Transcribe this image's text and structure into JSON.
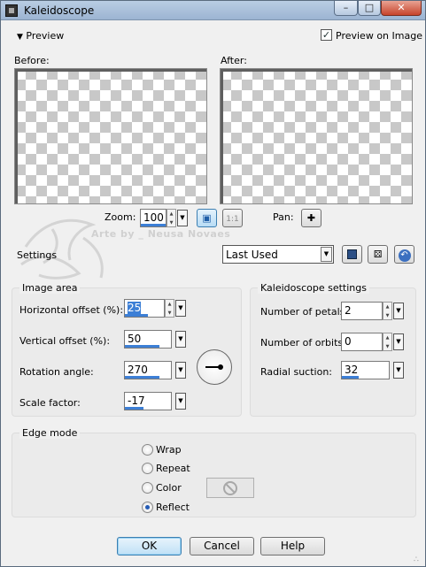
{
  "window": {
    "title": "Kaleidoscope"
  },
  "preview": {
    "toggle_label": "Preview",
    "preview_on_image_label": "Preview on Image",
    "preview_on_image_checked": true,
    "before_label": "Before:",
    "after_label": "After:"
  },
  "zoom": {
    "label": "Zoom:",
    "value": "100",
    "actual_size_label": "1:1"
  },
  "pan": {
    "label": "Pan:"
  },
  "watermark": {
    "text": "Arte by _ Neusa Novaes"
  },
  "settings": {
    "label": "Settings",
    "preset_value": "Last Used"
  },
  "image_area": {
    "title": "Image area",
    "fields": [
      {
        "label": "Horizontal offset (%):",
        "value": "25",
        "level": 0.6
      },
      {
        "label": "Vertical offset (%):",
        "value": "50",
        "level": 0.75
      },
      {
        "label": "Rotation angle:",
        "value": "270",
        "level": 0.75
      },
      {
        "label": "Scale factor:",
        "value": "-17",
        "level": 0.4
      }
    ]
  },
  "kaleidoscope": {
    "title": "Kaleidoscope settings",
    "fields": [
      {
        "label": "Number of petals:",
        "value": "2",
        "level": 0.0
      },
      {
        "label": "Number of orbits:",
        "value": "0",
        "level": 0.0
      },
      {
        "label": "Radial suction:",
        "value": "32",
        "level": 0.35
      }
    ]
  },
  "edge_mode": {
    "title": "Edge mode",
    "options": [
      {
        "label": "Wrap",
        "selected": false
      },
      {
        "label": "Repeat",
        "selected": false
      },
      {
        "label": "Color",
        "selected": false
      },
      {
        "label": "Reflect",
        "selected": true
      }
    ]
  },
  "buttons": {
    "ok": "OK",
    "cancel": "Cancel",
    "help": "Help"
  },
  "colors": {
    "accent": "#3c7fd6",
    "titlebar": "#b9cde3"
  }
}
